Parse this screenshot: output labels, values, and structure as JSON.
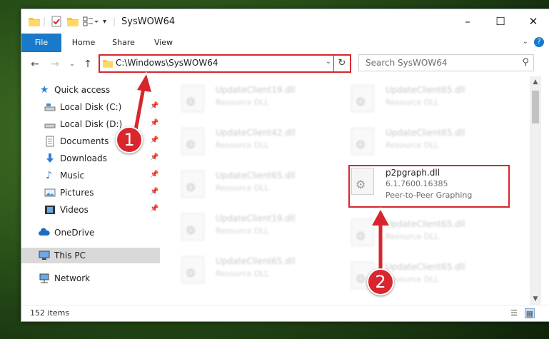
{
  "window": {
    "title": "SysWOW64",
    "controls": {
      "minimize": "–",
      "maximize": "☐",
      "close": "✕"
    }
  },
  "ribbon": {
    "tabs": [
      "File",
      "Home",
      "Share",
      "View"
    ],
    "help": "?"
  },
  "address_bar": {
    "path": "C:\\Windows\\SysWOW64",
    "refresh_icon": "refresh-icon"
  },
  "search": {
    "placeholder": "Search SysWOW64"
  },
  "nav_pane": {
    "items": [
      {
        "label": "Quick access",
        "icon": "star-icon",
        "pinned": false
      },
      {
        "label": "Local Disk (C:)",
        "icon": "drive-icon",
        "pinned": true
      },
      {
        "label": "Local Disk (D:)",
        "icon": "drive-icon",
        "pinned": true
      },
      {
        "label": "Documents",
        "icon": "documents-icon",
        "pinned": true
      },
      {
        "label": "Downloads",
        "icon": "download-icon",
        "pinned": true
      },
      {
        "label": "Music",
        "icon": "music-icon",
        "pinned": true
      },
      {
        "label": "Pictures",
        "icon": "pictures-icon",
        "pinned": true
      },
      {
        "label": "Videos",
        "icon": "videos-icon",
        "pinned": true
      },
      {
        "label": "OneDrive",
        "icon": "cloud-icon",
        "pinned": false
      },
      {
        "label": "This PC",
        "icon": "computer-icon",
        "pinned": false,
        "selected": true
      },
      {
        "label": "Network",
        "icon": "network-icon",
        "pinned": false
      }
    ]
  },
  "files": {
    "left": [
      {
        "name": "UpdateClient19.dll",
        "desc": "Resource DLL"
      },
      {
        "name": "UpdateClient42.dll",
        "desc": "Resource DLL"
      },
      {
        "name": "UpdateClient65.dll",
        "desc": "Resource DLL"
      },
      {
        "name": "UpdateClient19.dll",
        "desc": "Resource DLL"
      },
      {
        "name": "UpdateClient65.dll",
        "desc": "Resource DLL"
      }
    ],
    "right": [
      {
        "name": "UpdateClient65.dll",
        "desc": "Resource DLL"
      },
      {
        "name": "UpdateClient65.dll",
        "desc": "Resource DLL"
      },
      {
        "name": "p2pgraph.dll",
        "version": "6.1.7600.16385",
        "desc": "Peer-to-Peer Graphing",
        "highlighted": true
      },
      {
        "name": "UpdateClient65.dll",
        "desc": "Resource DLL"
      },
      {
        "name": "UpdateClient65.dll",
        "desc": "Resource DLL"
      }
    ]
  },
  "status_bar": {
    "item_count": "152 items"
  },
  "annotations": {
    "callout_1": "1",
    "callout_2": "2"
  },
  "colors": {
    "accent": "#1979ca",
    "highlight": "#d9252d"
  }
}
